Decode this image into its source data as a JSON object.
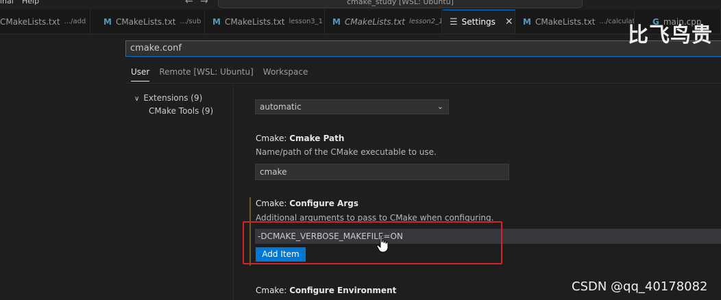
{
  "menu": {
    "terminal_label": "inal",
    "help_label": "Help"
  },
  "command_center": {
    "label": "cmake_study [WSL: Ubuntu]"
  },
  "tabs": [
    {
      "label": "CMakeLists.txt",
      "description": ".../add"
    },
    {
      "label": "CMakeLists.txt",
      "description": ".../sub"
    },
    {
      "label": "CMakeLists.txt",
      "description": "lesson3_1"
    },
    {
      "label": "CMakeLists.txt",
      "description": "lesson2_1"
    },
    {
      "label": "Settings"
    },
    {
      "label": "CMakeLists.txt",
      "description": ".../calculator"
    },
    {
      "label": "main.cpp"
    }
  ],
  "search": {
    "value": "cmake.conf"
  },
  "scopes": {
    "user": "User",
    "remote": "Remote [WSL: Ubuntu]",
    "workspace": "Workspace"
  },
  "tree": {
    "extensions": "Extensions (9)",
    "cmake_tools": "CMake Tools (9)"
  },
  "settings": {
    "prev_dropdown_value": "automatic",
    "cmake_path": {
      "prefix": "Cmake: ",
      "title": "Cmake Path",
      "description": "Name/path of the CMake executable to use.",
      "value": "cmake"
    },
    "configure_args": {
      "prefix": "Cmake: ",
      "title": "Configure Args",
      "description": "Additional arguments to pass to CMake when configuring.",
      "item": "-DCMAKE_VERBOSE_MAKEFILE=ON",
      "add_item_label": "Add Item"
    },
    "configure_env": {
      "prefix": "Cmake: ",
      "title": "Configure Environment"
    }
  },
  "watermarks": {
    "cn": "比飞鸟贵",
    "csdn": "CSDN @qq_40178082"
  },
  "colors": {
    "accent": "#0078d4",
    "highlight": "#d8232a",
    "cmake_icon": "#519aba"
  },
  "icons": {
    "cmake_tab": "m-icon",
    "settings_tab": "gear-icon",
    "cpp_tab": "c-icon",
    "close": "close-icon",
    "chevron": "chevron-down-icon",
    "cursor": "hand-cursor-icon"
  }
}
